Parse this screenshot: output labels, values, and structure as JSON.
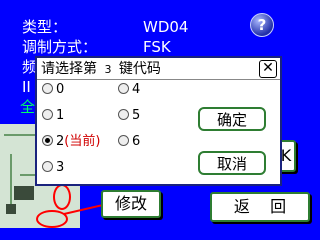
{
  "background": {
    "type_label": "类型：",
    "type_value": "WD04",
    "mod_label": "调制方式：",
    "mod_value": "FSK",
    "line3_partial": "频",
    "line4_partial": "II",
    "line5_partial": "全",
    "right_partial": "K"
  },
  "help_icon": "?",
  "buttons": {
    "modify": "修改",
    "back": "返    回"
  },
  "dialog": {
    "title_prefix": "请选择第",
    "title_number": "3",
    "title_suffix": "键代码",
    "close": "✕",
    "options": [
      {
        "label": "0",
        "checked": false
      },
      {
        "label": "1",
        "checked": false
      },
      {
        "label": "2",
        "tag": "(当前)",
        "checked": true
      },
      {
        "label": "3",
        "checked": false
      },
      {
        "label": "4",
        "checked": false
      },
      {
        "label": "5",
        "checked": false
      },
      {
        "label": "6",
        "checked": false
      }
    ],
    "confirm": "确定",
    "cancel": "取消"
  },
  "colors": {
    "background": "#0000ff",
    "accent": "#2e7d32",
    "highlight": "#ff0000"
  }
}
